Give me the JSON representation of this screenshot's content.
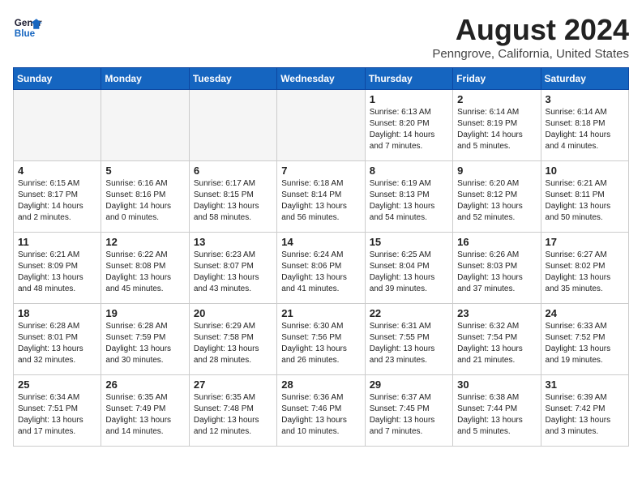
{
  "header": {
    "logo_general": "General",
    "logo_blue": "Blue",
    "month_title": "August 2024",
    "location": "Penngrove, California, United States"
  },
  "days_of_week": [
    "Sunday",
    "Monday",
    "Tuesday",
    "Wednesday",
    "Thursday",
    "Friday",
    "Saturday"
  ],
  "weeks": [
    [
      {
        "day": "",
        "content": ""
      },
      {
        "day": "",
        "content": ""
      },
      {
        "day": "",
        "content": ""
      },
      {
        "day": "",
        "content": ""
      },
      {
        "day": "1",
        "content": "Sunrise: 6:13 AM\nSunset: 8:20 PM\nDaylight: 14 hours\nand 7 minutes."
      },
      {
        "day": "2",
        "content": "Sunrise: 6:14 AM\nSunset: 8:19 PM\nDaylight: 14 hours\nand 5 minutes."
      },
      {
        "day": "3",
        "content": "Sunrise: 6:14 AM\nSunset: 8:18 PM\nDaylight: 14 hours\nand 4 minutes."
      }
    ],
    [
      {
        "day": "4",
        "content": "Sunrise: 6:15 AM\nSunset: 8:17 PM\nDaylight: 14 hours\nand 2 minutes."
      },
      {
        "day": "5",
        "content": "Sunrise: 6:16 AM\nSunset: 8:16 PM\nDaylight: 14 hours\nand 0 minutes."
      },
      {
        "day": "6",
        "content": "Sunrise: 6:17 AM\nSunset: 8:15 PM\nDaylight: 13 hours\nand 58 minutes."
      },
      {
        "day": "7",
        "content": "Sunrise: 6:18 AM\nSunset: 8:14 PM\nDaylight: 13 hours\nand 56 minutes."
      },
      {
        "day": "8",
        "content": "Sunrise: 6:19 AM\nSunset: 8:13 PM\nDaylight: 13 hours\nand 54 minutes."
      },
      {
        "day": "9",
        "content": "Sunrise: 6:20 AM\nSunset: 8:12 PM\nDaylight: 13 hours\nand 52 minutes."
      },
      {
        "day": "10",
        "content": "Sunrise: 6:21 AM\nSunset: 8:11 PM\nDaylight: 13 hours\nand 50 minutes."
      }
    ],
    [
      {
        "day": "11",
        "content": "Sunrise: 6:21 AM\nSunset: 8:09 PM\nDaylight: 13 hours\nand 48 minutes."
      },
      {
        "day": "12",
        "content": "Sunrise: 6:22 AM\nSunset: 8:08 PM\nDaylight: 13 hours\nand 45 minutes."
      },
      {
        "day": "13",
        "content": "Sunrise: 6:23 AM\nSunset: 8:07 PM\nDaylight: 13 hours\nand 43 minutes."
      },
      {
        "day": "14",
        "content": "Sunrise: 6:24 AM\nSunset: 8:06 PM\nDaylight: 13 hours\nand 41 minutes."
      },
      {
        "day": "15",
        "content": "Sunrise: 6:25 AM\nSunset: 8:04 PM\nDaylight: 13 hours\nand 39 minutes."
      },
      {
        "day": "16",
        "content": "Sunrise: 6:26 AM\nSunset: 8:03 PM\nDaylight: 13 hours\nand 37 minutes."
      },
      {
        "day": "17",
        "content": "Sunrise: 6:27 AM\nSunset: 8:02 PM\nDaylight: 13 hours\nand 35 minutes."
      }
    ],
    [
      {
        "day": "18",
        "content": "Sunrise: 6:28 AM\nSunset: 8:01 PM\nDaylight: 13 hours\nand 32 minutes."
      },
      {
        "day": "19",
        "content": "Sunrise: 6:28 AM\nSunset: 7:59 PM\nDaylight: 13 hours\nand 30 minutes."
      },
      {
        "day": "20",
        "content": "Sunrise: 6:29 AM\nSunset: 7:58 PM\nDaylight: 13 hours\nand 28 minutes."
      },
      {
        "day": "21",
        "content": "Sunrise: 6:30 AM\nSunset: 7:56 PM\nDaylight: 13 hours\nand 26 minutes."
      },
      {
        "day": "22",
        "content": "Sunrise: 6:31 AM\nSunset: 7:55 PM\nDaylight: 13 hours\nand 23 minutes."
      },
      {
        "day": "23",
        "content": "Sunrise: 6:32 AM\nSunset: 7:54 PM\nDaylight: 13 hours\nand 21 minutes."
      },
      {
        "day": "24",
        "content": "Sunrise: 6:33 AM\nSunset: 7:52 PM\nDaylight: 13 hours\nand 19 minutes."
      }
    ],
    [
      {
        "day": "25",
        "content": "Sunrise: 6:34 AM\nSunset: 7:51 PM\nDaylight: 13 hours\nand 17 minutes."
      },
      {
        "day": "26",
        "content": "Sunrise: 6:35 AM\nSunset: 7:49 PM\nDaylight: 13 hours\nand 14 minutes."
      },
      {
        "day": "27",
        "content": "Sunrise: 6:35 AM\nSunset: 7:48 PM\nDaylight: 13 hours\nand 12 minutes."
      },
      {
        "day": "28",
        "content": "Sunrise: 6:36 AM\nSunset: 7:46 PM\nDaylight: 13 hours\nand 10 minutes."
      },
      {
        "day": "29",
        "content": "Sunrise: 6:37 AM\nSunset: 7:45 PM\nDaylight: 13 hours\nand 7 minutes."
      },
      {
        "day": "30",
        "content": "Sunrise: 6:38 AM\nSunset: 7:44 PM\nDaylight: 13 hours\nand 5 minutes."
      },
      {
        "day": "31",
        "content": "Sunrise: 6:39 AM\nSunset: 7:42 PM\nDaylight: 13 hours\nand 3 minutes."
      }
    ]
  ]
}
